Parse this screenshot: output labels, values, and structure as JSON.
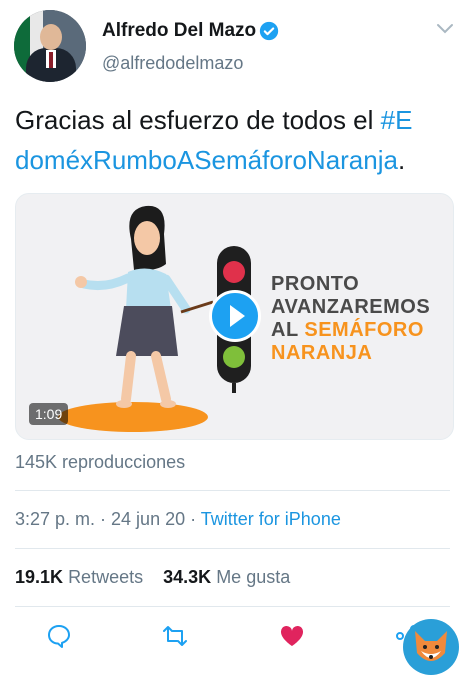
{
  "user": {
    "name": "Alfredo Del Mazo",
    "handle": "@alfredodelmazo"
  },
  "tweet": {
    "text_plain": "Gracias al esfuerzo de todos el ",
    "hashtag_line1": "#E",
    "hashtag_line2": "doméxRumboASemáforoNaranja",
    "text_end": "."
  },
  "media": {
    "title_line1": "PRONTO",
    "title_line2": "AVANZAREMOS",
    "title_line3_prefix": "AL ",
    "title_line3_highlight": "SEMÁFORO",
    "title_line4": "NARANJA",
    "duration": "1:09"
  },
  "views": "145K reproducciones",
  "meta": {
    "time": "3:27 p. m. · 24 jun 20 · ",
    "client": "Twitter for iPhone"
  },
  "stats": {
    "retweets_count": "19.1K",
    "retweets_label": "Retweets",
    "likes_count": "34.3K",
    "likes_label": "Me gusta"
  },
  "icons": {
    "reply": "reply-icon",
    "retweet": "retweet-icon",
    "like": "like-icon",
    "share": "share-icon"
  },
  "colors": {
    "link": "#1b95e0",
    "like": "#e0245e",
    "play": "#1da1f2",
    "accent_orange": "#f7931e"
  }
}
